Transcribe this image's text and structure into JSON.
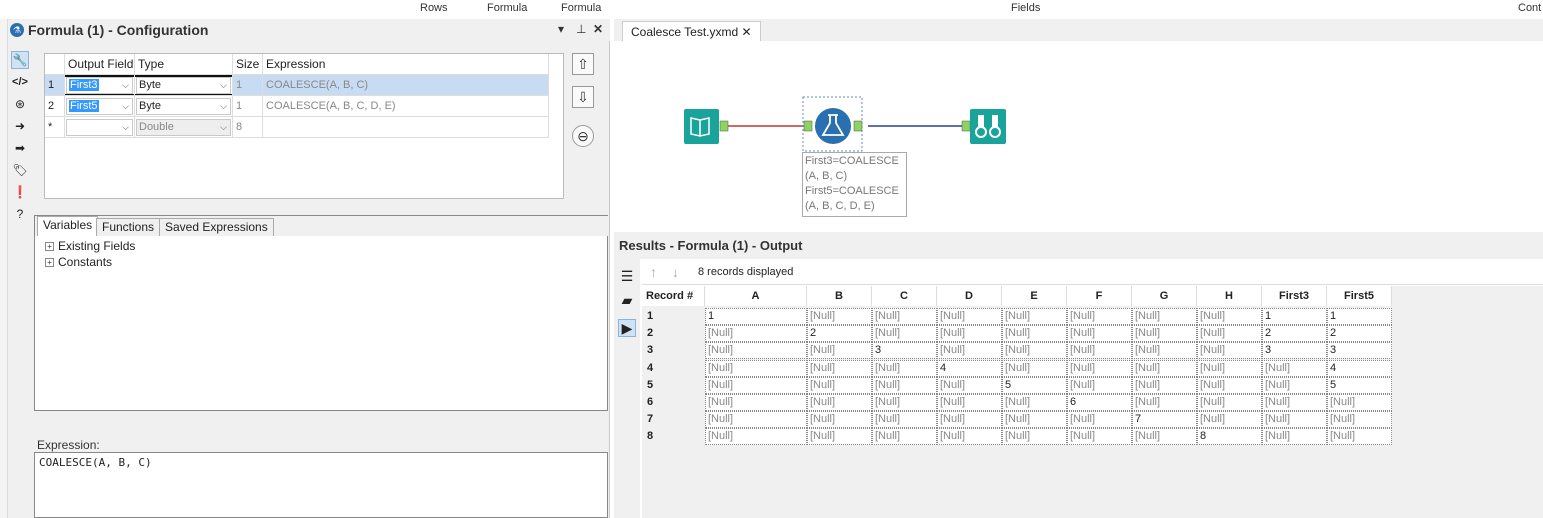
{
  "ribbon": {
    "labels": [
      "Rows",
      "Formula",
      "Formula",
      "Fields",
      "Cont"
    ]
  },
  "config": {
    "title": "Formula (1) - Configuration",
    "window_buttons": {
      "dropdown": "▾",
      "pin": "⊥",
      "close": "✕"
    },
    "grid": {
      "headers": [
        "Output Field",
        "Type",
        "Size",
        "Expression"
      ],
      "rows": [
        {
          "num": "1",
          "field": "First3",
          "type": "Byte",
          "size": "1",
          "expression": "COALESCE(A, B, C)"
        },
        {
          "num": "2",
          "field": "First5",
          "type": "Byte",
          "size": "1",
          "expression": "COALESCE(A, B, C, D, E)"
        },
        {
          "num": "*",
          "field": "",
          "type": "Double",
          "size": "8",
          "expression": ""
        }
      ]
    },
    "tabs": [
      "Variables",
      "Functions",
      "Saved Expressions"
    ],
    "tree": [
      "Existing Fields",
      "Constants"
    ],
    "expression_label": "Expression:",
    "expression_value": "COALESCE(A, B, C)"
  },
  "canvas": {
    "doc_tab": "Coalesce Test.yxmd",
    "annotation": "First3=COALESCE\n(A, B, C)\nFirst5=COALESCE\n(A, B, C, D, E)"
  },
  "results": {
    "title": "Results - Formula (1) - Output",
    "record_count": "8 records displayed",
    "columns": [
      "Record #",
      "A",
      "B",
      "C",
      "D",
      "E",
      "F",
      "G",
      "H",
      "First3",
      "First5"
    ],
    "rows": [
      [
        "1",
        "1",
        "[Null]",
        "[Null]",
        "[Null]",
        "[Null]",
        "[Null]",
        "[Null]",
        "[Null]",
        "1",
        "1"
      ],
      [
        "2",
        "[Null]",
        "2",
        "[Null]",
        "[Null]",
        "[Null]",
        "[Null]",
        "[Null]",
        "[Null]",
        "2",
        "2"
      ],
      [
        "3",
        "[Null]",
        "[Null]",
        "3",
        "[Null]",
        "[Null]",
        "[Null]",
        "[Null]",
        "[Null]",
        "3",
        "3"
      ],
      [
        "4",
        "[Null]",
        "[Null]",
        "[Null]",
        "4",
        "[Null]",
        "[Null]",
        "[Null]",
        "[Null]",
        "[Null]",
        "4"
      ],
      [
        "5",
        "[Null]",
        "[Null]",
        "[Null]",
        "[Null]",
        "5",
        "[Null]",
        "[Null]",
        "[Null]",
        "[Null]",
        "5"
      ],
      [
        "6",
        "[Null]",
        "[Null]",
        "[Null]",
        "[Null]",
        "[Null]",
        "6",
        "[Null]",
        "[Null]",
        "[Null]",
        "[Null]"
      ],
      [
        "7",
        "[Null]",
        "[Null]",
        "[Null]",
        "[Null]",
        "[Null]",
        "[Null]",
        "7",
        "[Null]",
        "[Null]",
        "[Null]"
      ],
      [
        "8",
        "[Null]",
        "[Null]",
        "[Null]",
        "[Null]",
        "[Null]",
        "[Null]",
        "[Null]",
        "8",
        "[Null]",
        "[Null]"
      ]
    ]
  },
  "colors": {
    "accent": "#2a6fb0",
    "tool_teal": "#1aa39a",
    "connector_red": "#c0392b",
    "connector_blue": "#2c3e9e"
  }
}
